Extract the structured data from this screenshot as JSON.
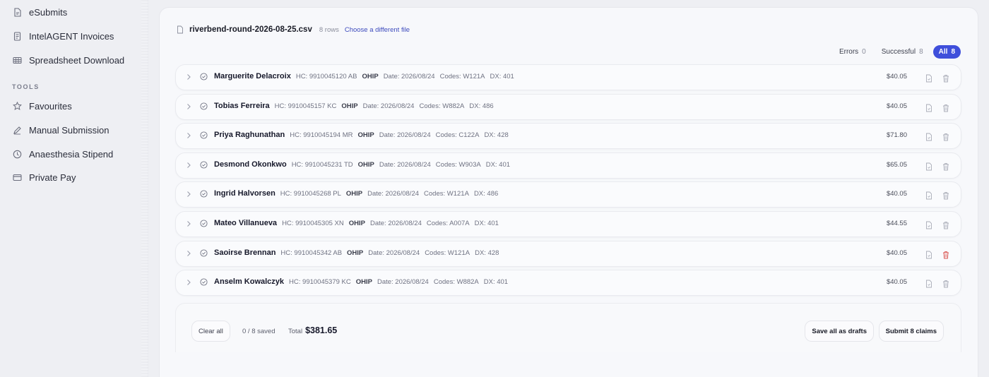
{
  "sidebar": {
    "items_top": [
      {
        "label": "eSubmits",
        "icon": "doc-icon"
      },
      {
        "label": "IntelAGENT Invoices",
        "icon": "invoice-icon"
      },
      {
        "label": "Spreadsheet Download",
        "icon": "table-icon"
      }
    ],
    "tools_label": "TOOLS",
    "tools": [
      {
        "label": "Favourites",
        "icon": "star-icon"
      },
      {
        "label": "Manual Submission",
        "icon": "pencil-icon"
      },
      {
        "label": "Anaesthesia Stipend",
        "icon": "clock-icon"
      },
      {
        "label": "Private Pay",
        "icon": "card-icon"
      }
    ]
  },
  "file": {
    "name": "riverbend-round-2026-08-25.csv",
    "rows": "8 rows",
    "change_link": "Choose a different file"
  },
  "filters": [
    {
      "label": "Errors",
      "count": "0",
      "active": false
    },
    {
      "label": "Successful",
      "count": "8",
      "active": false
    },
    {
      "label": "All",
      "count": "8",
      "active": true
    }
  ],
  "claims": [
    {
      "name": "Marguerite Delacroix",
      "hc": "HC: 9910045120 AB",
      "payer": "OHIP",
      "date": "Date: 2026/08/24",
      "codes": "Codes: W121A",
      "dx": "DX: 401",
      "amount": "$40.05"
    },
    {
      "name": "Tobias Ferreira",
      "hc": "HC: 9910045157 KC",
      "payer": "OHIP",
      "date": "Date: 2026/08/24",
      "codes": "Codes: W882A",
      "dx": "DX: 486",
      "amount": "$40.05"
    },
    {
      "name": "Priya Raghunathan",
      "hc": "HC: 9910045194 MR",
      "payer": "OHIP",
      "date": "Date: 2026/08/24",
      "codes": "Codes: C122A",
      "dx": "DX: 428",
      "amount": "$71.80"
    },
    {
      "name": "Desmond Okonkwo",
      "hc": "HC: 9910045231 TD",
      "payer": "OHIP",
      "date": "Date: 2026/08/24",
      "codes": "Codes: W903A",
      "dx": "DX: 401",
      "amount": "$65.05"
    },
    {
      "name": "Ingrid Halvorsen",
      "hc": "HC: 9910045268 PL",
      "payer": "OHIP",
      "date": "Date: 2026/08/24",
      "codes": "Codes: W121A",
      "dx": "DX: 486",
      "amount": "$40.05"
    },
    {
      "name": "Mateo Villanueva",
      "hc": "HC: 9910045305 XN",
      "payer": "OHIP",
      "date": "Date: 2026/08/24",
      "codes": "Codes: A007A",
      "dx": "DX: 401",
      "amount": "$44.55"
    },
    {
      "name": "Saoirse Brennan",
      "hc": "HC: 9910045342 AB",
      "payer": "OHIP",
      "date": "Date: 2026/08/24",
      "codes": "Codes: W121A",
      "dx": "DX: 428",
      "amount": "$40.05",
      "trash_hover": true
    },
    {
      "name": "Anselm Kowalczyk",
      "hc": "HC: 9910045379 KC",
      "payer": "OHIP",
      "date": "Date: 2026/08/24",
      "codes": "Codes: W882A",
      "dx": "DX: 401",
      "amount": "$40.05"
    }
  ],
  "footer": {
    "clear_label": "Clear all",
    "saved": "0 / 8 saved",
    "total_label": "Total",
    "total_value": "$381.65",
    "drafts_label": "Save all as drafts",
    "submit_label": "Submit 8 claims"
  },
  "colors": {
    "accent": "#3f4fdb",
    "danger": "#d9534f"
  }
}
